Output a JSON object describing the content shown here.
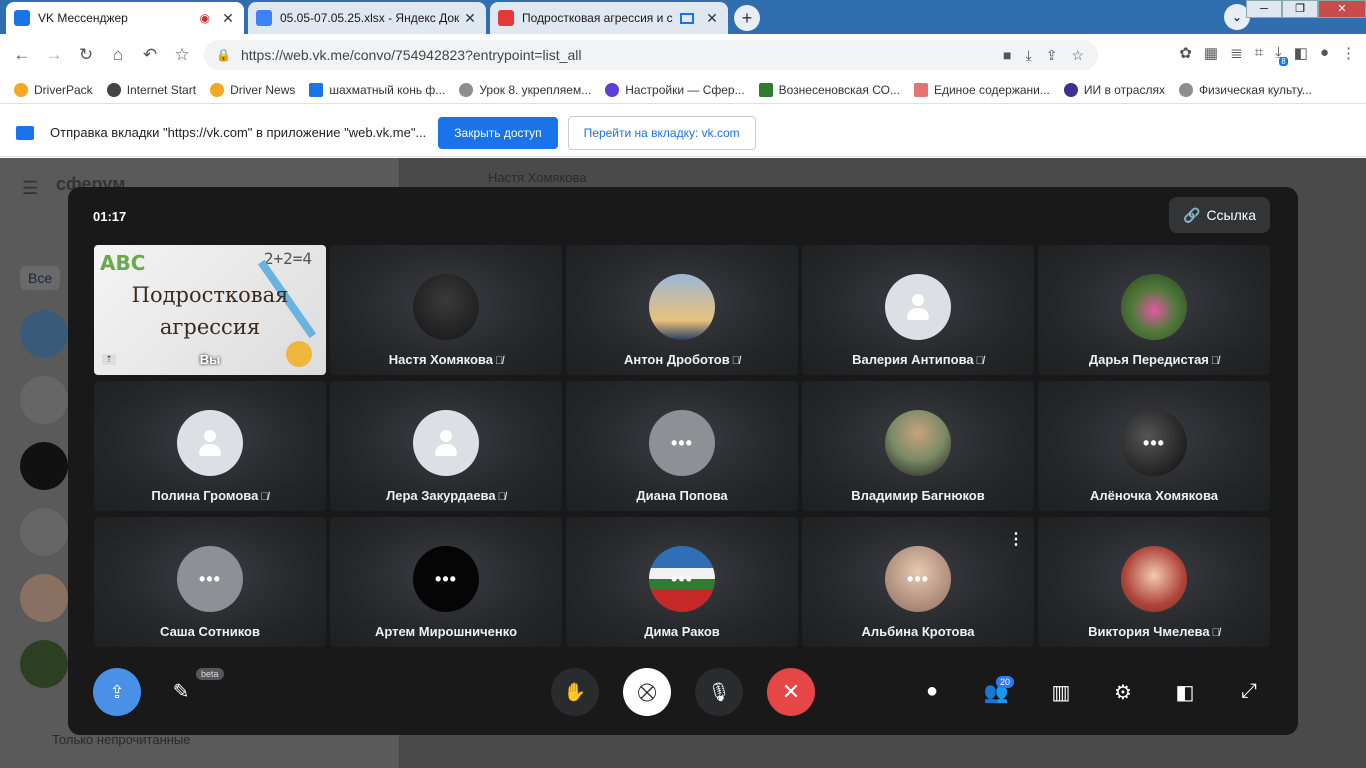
{
  "browser": {
    "tabs": [
      {
        "title": "VK Мессенджер",
        "fav_color": "#1a73e8",
        "active": true
      },
      {
        "title": "05.05-07.05.25.xlsx - Яндекс Док",
        "fav_color": "#3b82f6",
        "active": false
      },
      {
        "title": "Подростковая агрессия и с",
        "fav_color": "#e53935",
        "active": false
      }
    ],
    "close_glyph": "✕",
    "new_tab_glyph": "+",
    "url": "https://web.vk.me/convo/754942823?entrypoint=list_all",
    "downloads_badge": "8",
    "bookmarks": [
      {
        "label": "DriverPack",
        "color": "#f5a623"
      },
      {
        "label": "Internet Start",
        "color": "#444"
      },
      {
        "label": "Driver News",
        "color": "#f5a623"
      },
      {
        "label": "шахматный конь ф...",
        "color": "#1a73e8"
      },
      {
        "label": "Урок 8. укрепляем...",
        "color": "#8e8e8e"
      },
      {
        "label": "Настройки — Сфер...",
        "color": "#5b3fd6"
      },
      {
        "label": "Вознесеновская СО...",
        "color": "#2e7d32"
      },
      {
        "label": "Единое содержани...",
        "color": "#e57373"
      },
      {
        "label": "ИИ в отраслях",
        "color": "#3f2f8f"
      },
      {
        "label": "Физическая культу...",
        "color": "#8e8e8e"
      }
    ]
  },
  "infobar": {
    "message": "Отправка вкладки \"https://vk.com\" в приложение \"web.vk.me\"...",
    "close_access": "Закрыть доступ",
    "go_to_tab": "Перейти на вкладку: vk.com"
  },
  "background": {
    "brand": "сферум",
    "filter_all": "Все",
    "unread_only": "Только непрочитанные",
    "chat_title": "Настя Хомякова"
  },
  "call": {
    "timer": "01:17",
    "link_label": "Ссылка",
    "share": {
      "title_line1": "Подростковая",
      "title_line2": "агрессия",
      "abc": "ABC",
      "math": "2+2=4",
      "you_label": "Вы"
    },
    "participants": [
      {
        "name": "Настя Хомякова",
        "muted": true,
        "avatar": "photo1"
      },
      {
        "name": "Антон Дроботов",
        "muted": true,
        "avatar": "photo2"
      },
      {
        "name": "Валерия Антипова",
        "muted": true,
        "avatar": "placeholder"
      },
      {
        "name": "Дарья Передистая",
        "muted": true,
        "avatar": "photo3"
      },
      {
        "name": "Полина Громова",
        "muted": true,
        "avatar": "placeholder"
      },
      {
        "name": "Лера Закурдаева",
        "muted": true,
        "avatar": "placeholder"
      },
      {
        "name": "Диана Попова",
        "muted": false,
        "avatar": "grey-dots"
      },
      {
        "name": "Владимир Багнюков",
        "muted": false,
        "avatar": "photo4"
      },
      {
        "name": "Алёночка Хомякова",
        "muted": false,
        "avatar": "photo5-dots"
      },
      {
        "name": "Саша Сотников",
        "muted": false,
        "avatar": "grey-dots"
      },
      {
        "name": "Артем Мирошниченко",
        "muted": false,
        "avatar": "black-dots"
      },
      {
        "name": "Дима Раков",
        "muted": false,
        "avatar": "photo6-dots"
      },
      {
        "name": "Альбина Кротова",
        "muted": false,
        "avatar": "photo7-dots"
      },
      {
        "name": "Виктория Чмелева",
        "muted": true,
        "avatar": "photo8"
      }
    ],
    "controls": {
      "beta_label": "beta",
      "participants_count": "20"
    }
  }
}
